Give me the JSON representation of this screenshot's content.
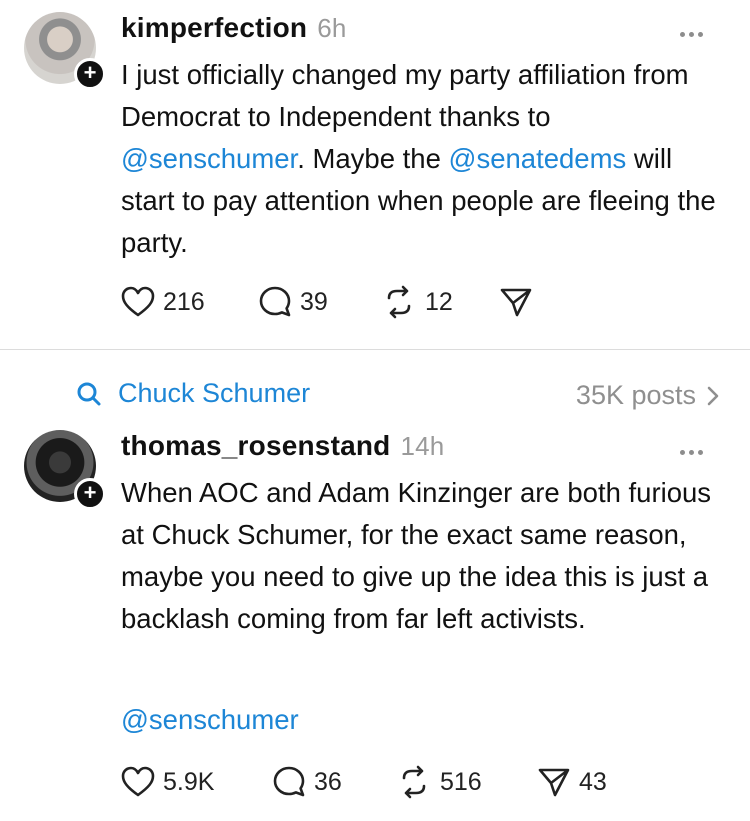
{
  "posts": [
    {
      "username": "kimperfection",
      "time": "6h",
      "body": [
        {
          "t": "I just officially changed my party affiliation from Democrat to Independent thanks to ",
          "m": false
        },
        {
          "t": "@senschumer",
          "m": true
        },
        {
          "t": ". Maybe the ",
          "m": false
        },
        {
          "t": "@senatedems",
          "m": true
        },
        {
          "t": " will start to pay attention when people are fleeing the party.",
          "m": false
        }
      ],
      "likes": "216",
      "replies": "39",
      "reposts": "12",
      "shares": ""
    },
    {
      "username": "thomas_rosenstand",
      "time": "14h",
      "body": [
        {
          "t": "When AOC and Adam Kinzinger are both furious at Chuck Schumer, for the exact same reason, maybe you need to give up the idea this is just a backlash coming from far left activists.",
          "m": false
        }
      ],
      "mention_line": "@senschumer",
      "likes": "5.9K",
      "replies": "36",
      "reposts": "516",
      "shares": "43"
    }
  ],
  "topic": {
    "label": "Chuck Schumer",
    "count": "35K posts",
    "icon": "search-icon"
  },
  "colors": {
    "link": "#1d86d6",
    "muted": "#9a9a9a"
  }
}
